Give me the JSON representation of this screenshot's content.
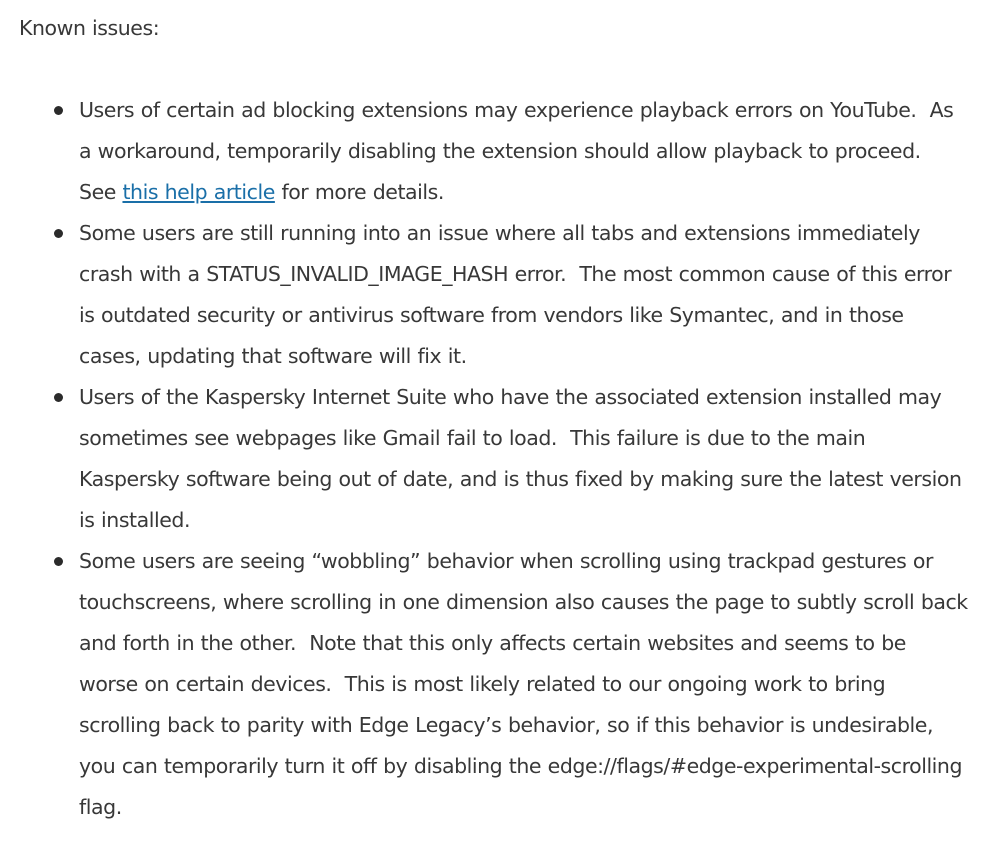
{
  "heading": "Known issues:",
  "issues": [
    {
      "before": "Users of certain ad blocking extensions may experience playback errors on YouTube.  As a workaround, temporarily disabling the extension should allow playback to proceed.  See ",
      "link_text": "this help article",
      "after": " for more details."
    },
    {
      "text": "Some users are still running into an issue where all tabs and extensions immediately crash with a STATUS_INVALID_IMAGE_HASH error.  The most common cause of this error is outdated security or antivirus software from vendors like Symantec, and in those cases, updating that software will fix it."
    },
    {
      "text": "Users of the Kaspersky Internet Suite who have the associated extension installed may sometimes see webpages like Gmail fail to load.  This failure is due to the main Kaspersky software being out of date, and is thus fixed by making sure the latest version is installed."
    },
    {
      "text": "Some users are seeing “wobbling” behavior when scrolling using trackpad gestures or touchscreens, where scrolling in one dimension also causes the page to subtly scroll back and forth in the other.  Note that this only affects certain websites and seems to be worse on certain devices.  This is most likely related to our ongoing work to bring scrolling back to parity with Edge Legacy’s behavior, so if this behavior is undesirable, you can temporarily turn it off by disabling the edge://flags/#edge-experimental-scrolling flag."
    }
  ],
  "colors": {
    "text": "#383838",
    "link": "#1a6fa8",
    "background": "#ffffff"
  }
}
